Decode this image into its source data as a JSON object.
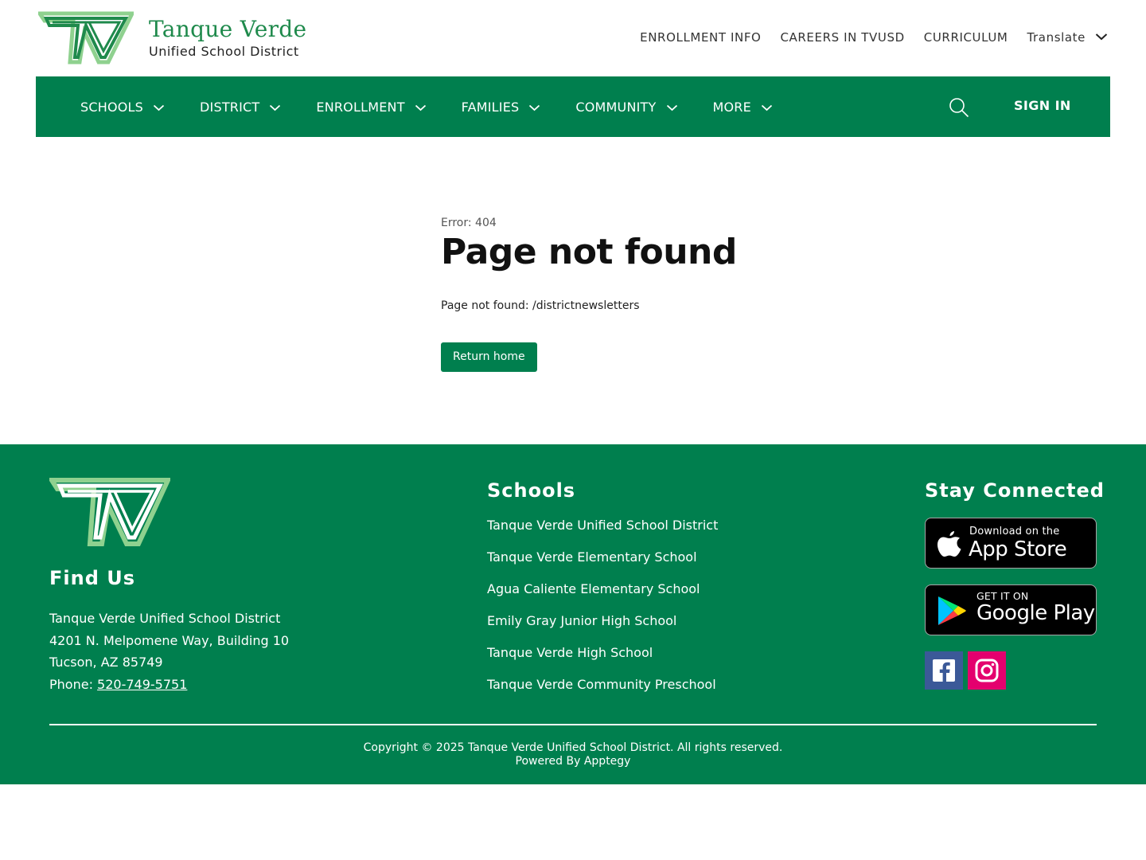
{
  "brand": {
    "name": "Tanque Verde",
    "subtitle": "Unified School District",
    "logo_icon": "tv-logo-icon",
    "colors": {
      "primary_green": "#007f4e",
      "logo_green": "#1f8a4c",
      "logo_light": "#8fd18f"
    }
  },
  "utility_nav": {
    "items": [
      "ENROLLMENT INFO",
      "CAREERS IN TVUSD",
      "CURRICULUM"
    ],
    "translate_label": "Translate"
  },
  "main_nav": {
    "items": [
      "SCHOOLS",
      "DISTRICT",
      "ENROLLMENT",
      "FAMILIES",
      "COMMUNITY",
      "MORE"
    ],
    "search_icon": "search-icon",
    "sign_in": "SIGN IN"
  },
  "error": {
    "code_label": "Error: 404",
    "title": "Page not found",
    "message": "Page not found: /districtnewsletters",
    "button": "Return home"
  },
  "footer": {
    "find_us": {
      "heading": "Find Us",
      "name": "Tanque Verde Unified School District",
      "street": "4201 N. Melpomene Way, Building 10",
      "city": "Tucson, AZ 85749",
      "phone_label": "Phone: ",
      "phone": "520-749-5751"
    },
    "schools": {
      "heading": "Schools",
      "items": [
        "Tanque Verde Unified School District",
        "Tanque Verde Elementary School",
        "Agua Caliente Elementary School",
        "Emily Gray Junior High School",
        "Tanque Verde High School",
        "Tanque Verde Community Preschool"
      ]
    },
    "stay_connected": {
      "heading": "Stay Connected",
      "app_store": {
        "small": "Download on the",
        "big": "App Store",
        "icon": "apple-icon"
      },
      "google_play": {
        "small": "GET IT ON",
        "big": "Google Play",
        "icon": "google-play-icon"
      },
      "social": [
        "facebook-icon",
        "instagram-icon"
      ]
    },
    "copyright": "Copyright © 2025 Tanque Verde Unified School District. All rights reserved.",
    "powered_by": "Powered By Apptegy"
  }
}
